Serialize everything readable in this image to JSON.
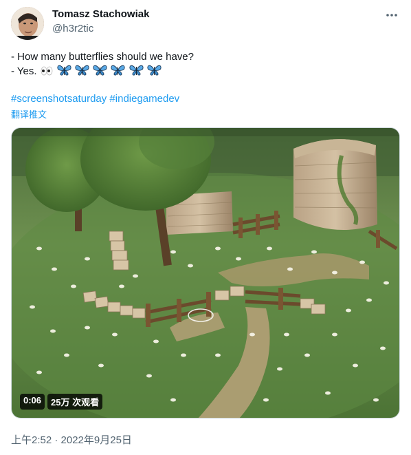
{
  "author": {
    "display_name": "Tomasz Stachowiak",
    "handle": "@h3r2tic"
  },
  "tweet": {
    "line1": "- How many butterflies should we have?",
    "line2_prefix": "- Yes.",
    "line2_emoji": "eyes-icon, 6 blue-butterfly-icons",
    "hashtags": [
      "#screenshotsaturday",
      "#indiegamedev"
    ],
    "translate_label": "翻译推文"
  },
  "media": {
    "duration": "0:06",
    "views": "25万 次观看"
  },
  "timestamp": "上午2:52 · 2022年9月25日",
  "colors": {
    "link": "#1d9bf0",
    "muted": "#536471",
    "text": "#0f1419"
  }
}
